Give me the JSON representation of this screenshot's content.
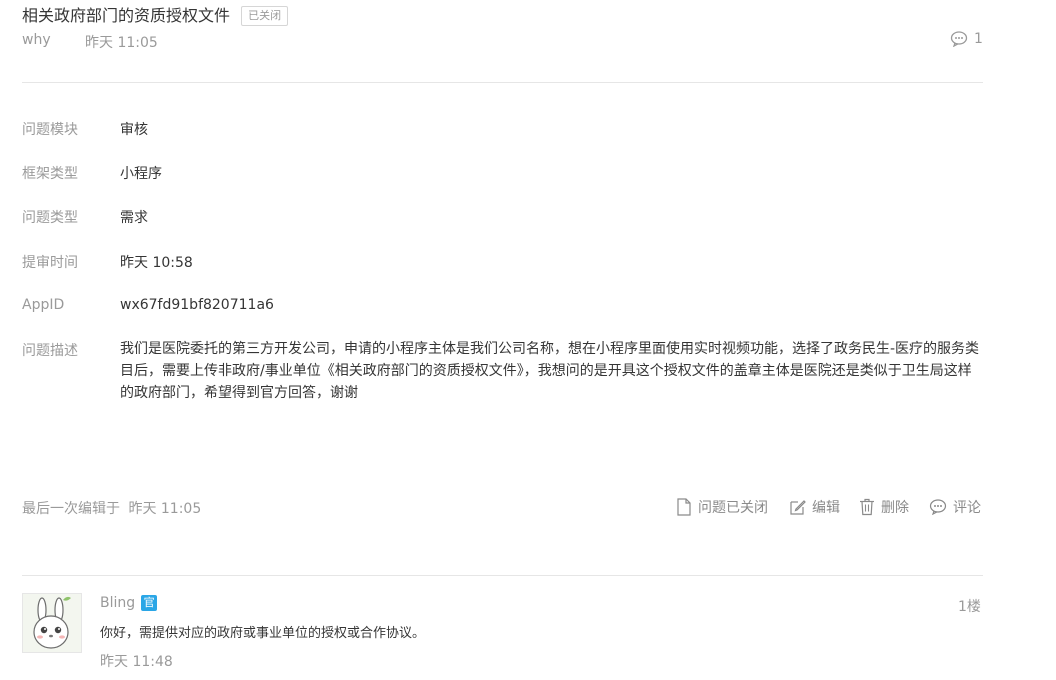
{
  "post": {
    "title": "相关政府部门的资质授权文件",
    "status_badge": "已关闭",
    "author": "why",
    "time": "昨天 11:05",
    "comment_count": "1"
  },
  "details": {
    "module": {
      "label": "问题模块",
      "value": "审核"
    },
    "framework": {
      "label": "框架类型",
      "value": "小程序"
    },
    "issue_type": {
      "label": "问题类型",
      "value": "需求"
    },
    "submit_time": {
      "label": "提审时间",
      "value": "昨天 10:58"
    },
    "appid": {
      "label": "AppID",
      "value": "wx67fd91bf820711a6"
    },
    "description": {
      "label": "问题描述",
      "value": "我们是医院委托的第三方开发公司，申请的小程序主体是我们公司名称，想在小程序里面使用实时视频功能，选择了政务民生-医疗的服务类目后，需要上传非政府/事业单位《相关政府部门的资质授权文件》，我想问的是开具这个授权文件的盖章主体是医院还是类似于卫生局这样的政府部门，希望得到官方回答，谢谢"
    }
  },
  "footer": {
    "last_edit_label": "最后一次编辑于",
    "last_edit_time": "昨天 11:05",
    "actions": {
      "closed": "问题已关闭",
      "edit": "编辑",
      "delete": "删除",
      "comment": "评论"
    }
  },
  "reply": {
    "author": "Bling",
    "official_badge": "官",
    "floor": "1楼",
    "text": "你好，需提供对应的政府或事业单位的授权或合作协议。",
    "time": "昨天 11:48"
  },
  "icons": {
    "comment": "comment-bubble-icon",
    "closed": "document-icon",
    "edit": "pencil-icon",
    "delete": "trash-icon",
    "avatar": "rabbit-avatar"
  }
}
